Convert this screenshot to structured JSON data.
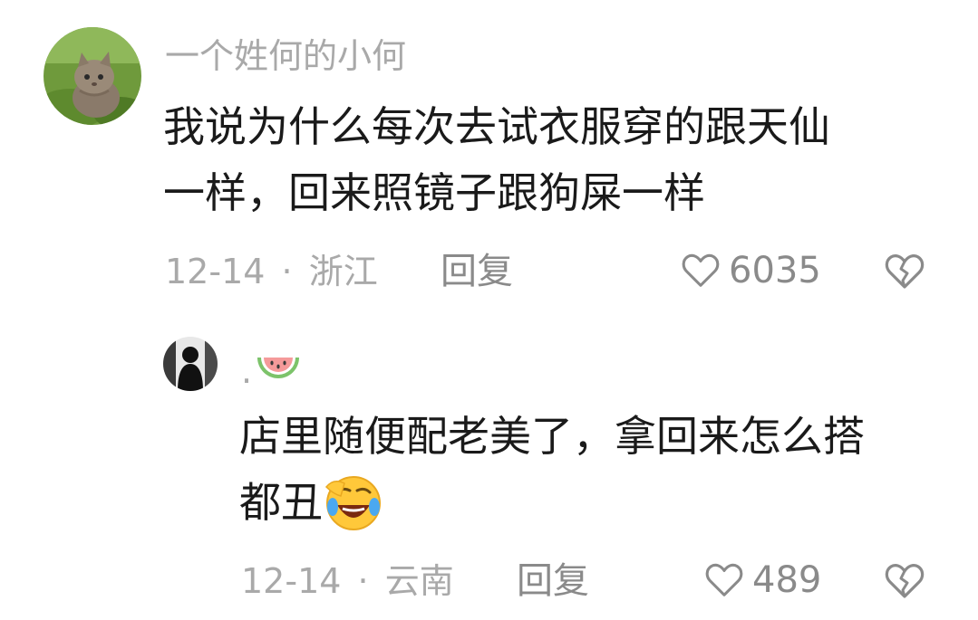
{
  "comments": [
    {
      "username": "一个姓何的小何",
      "text_line1": "我说为什么每次去试衣服穿的跟天仙",
      "text_line2": "一样，回来照镜子跟狗屎一样",
      "date": "12-14",
      "separator": "·",
      "location": "浙江",
      "reply_label": "回复",
      "like_count": "6035"
    },
    {
      "username": ".",
      "text_line1": "店里随便配老美了，拿回来怎么搭",
      "text_line2": "都丑",
      "date": "12-14",
      "separator": "·",
      "location": "云南",
      "reply_label": "回复",
      "like_count": "489"
    }
  ],
  "icons": {
    "like": "heart-outline-icon",
    "dislike": "broken-heart-icon",
    "emoji_name": "watermelon-icon",
    "emoji_text": "laughing-crying-face-icon"
  },
  "colors": {
    "text_primary": "#1a1a1a",
    "text_secondary": "#a9a9a9",
    "action": "#8a8a8a"
  }
}
